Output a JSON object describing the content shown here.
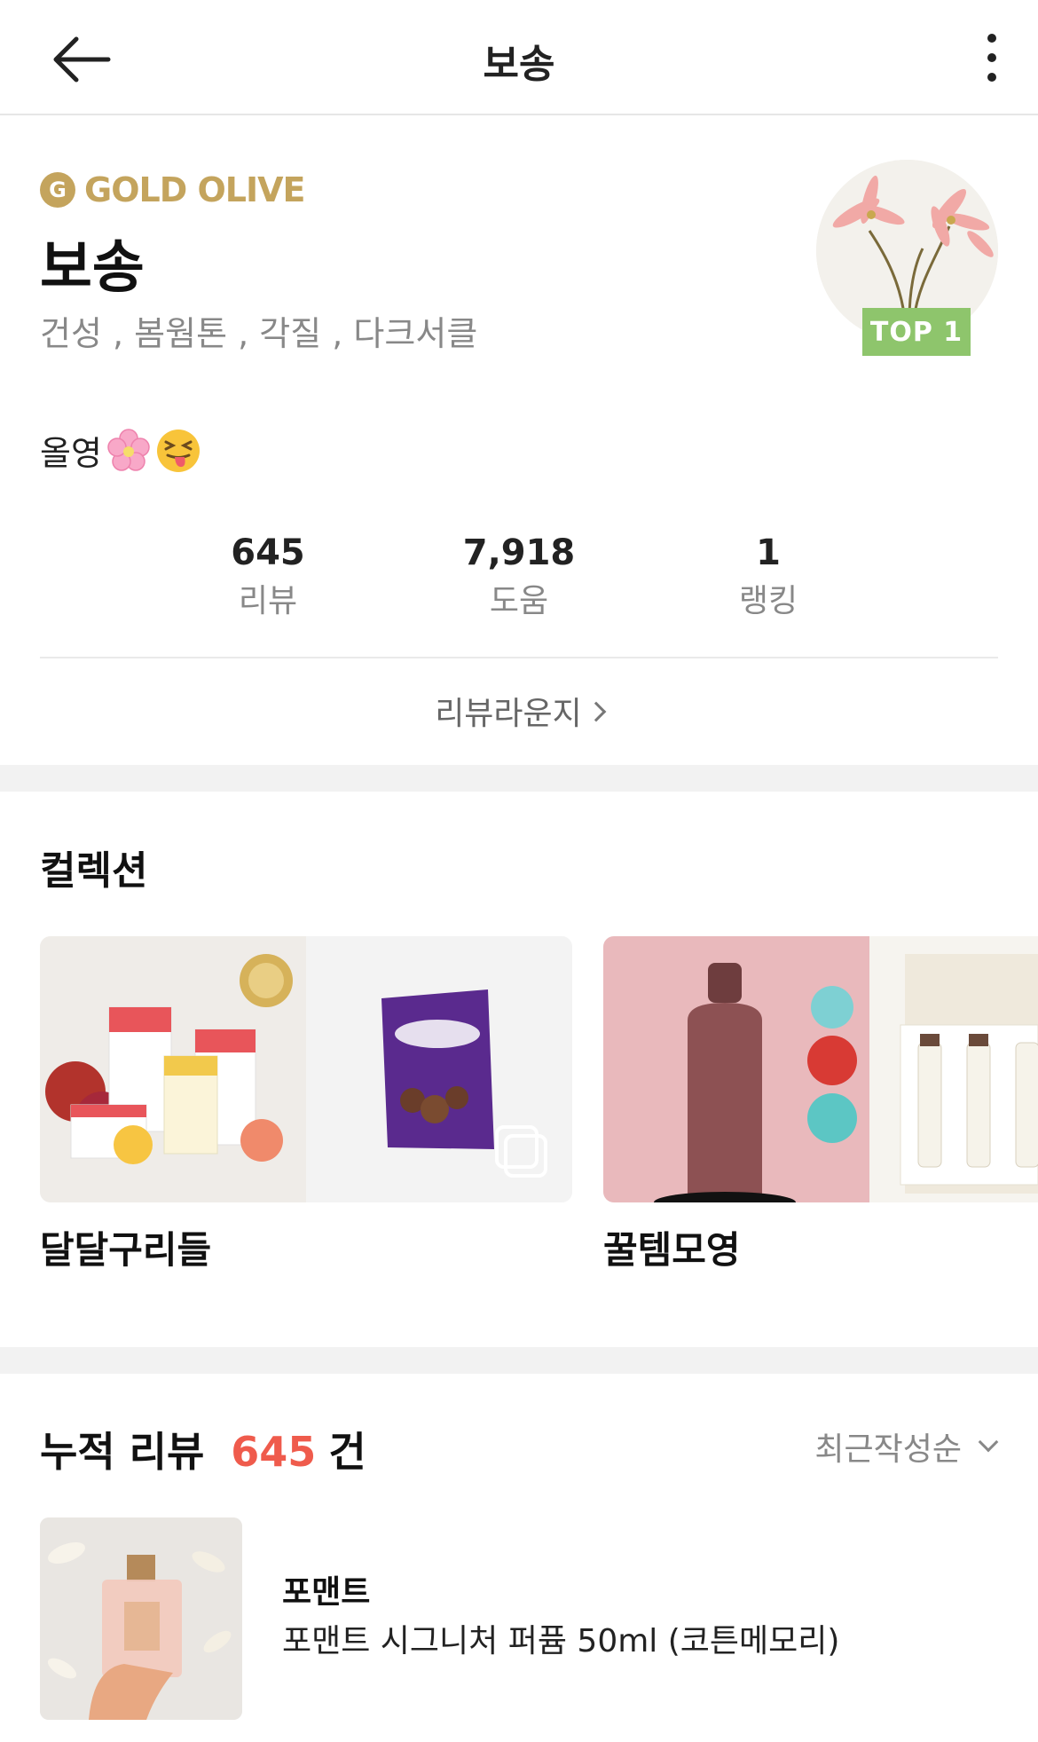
{
  "header": {
    "title": "보송",
    "back_icon": "arrow-left-icon",
    "more_icon": "more-vertical-icon"
  },
  "profile": {
    "grade_initial": "G",
    "grade_label": "GOLD OLIVE",
    "nickname": "보송",
    "skin_tags": "건성 , 봄웜톤 , 각질 , 다크서클",
    "rank_badge": "TOP 1",
    "intro_text": "올영",
    "intro_emojis": [
      "cherry-blossom-icon",
      "squinting-tongue-face-icon"
    ],
    "gold_color": "#c4a45d",
    "badge_color": "#8ec56c"
  },
  "stats": [
    {
      "value": "645",
      "label": "리뷰"
    },
    {
      "value": "7,918",
      "label": "도움"
    },
    {
      "value": "1",
      "label": "랭킹"
    }
  ],
  "lounge": {
    "label": "리뷰라운지"
  },
  "collections": {
    "title": "컬렉션",
    "items": [
      {
        "name": "달달구리들"
      },
      {
        "name": "꿀템모영"
      }
    ]
  },
  "reviews": {
    "title": "누적 리뷰",
    "count": "645",
    "unit": "건",
    "sort_label": "최근작성순",
    "accent_color": "#ef5b4c",
    "items": [
      {
        "brand": "포맨트",
        "product": "포맨트 시그니처 퍼퓸 50ml (코튼메모리)"
      }
    ]
  }
}
